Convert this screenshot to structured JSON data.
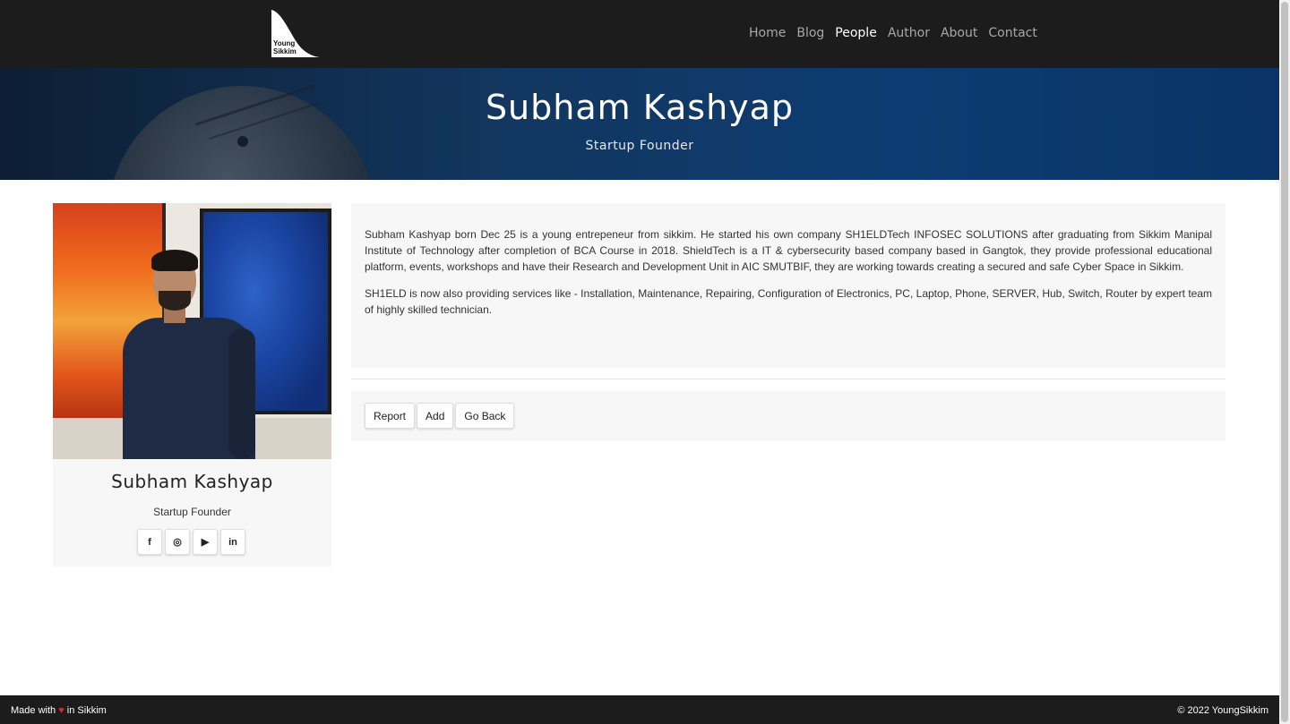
{
  "logo": {
    "text_line1": "Young",
    "text_line2": "Sikkim"
  },
  "nav": {
    "items": [
      {
        "label": "Home",
        "active": false
      },
      {
        "label": "Blog",
        "active": false
      },
      {
        "label": "People",
        "active": true
      },
      {
        "label": "Author",
        "active": false
      },
      {
        "label": "About",
        "active": false
      },
      {
        "label": "Contact",
        "active": false
      }
    ]
  },
  "hero": {
    "title": "Subham Kashyap",
    "subtitle": "Startup Founder"
  },
  "profile": {
    "name": "Subham Kashyap",
    "role": "Startup Founder",
    "socials": [
      {
        "name": "facebook-icon",
        "glyph": "f"
      },
      {
        "name": "instagram-icon",
        "glyph": "◎"
      },
      {
        "name": "youtube-icon",
        "glyph": "▶"
      },
      {
        "name": "linkedin-icon",
        "glyph": "in"
      }
    ]
  },
  "bio": {
    "paragraphs": [
      "Subham Kashyap born Dec 25 is a young entrepeneur from sikkim. He started his own company SH1ELDTech INFOSEC SOLUTIONS after graduating from Sikkim Manipal Institute of Technology after completion of BCA Course in 2018. ShieldTech is a IT & cybersecurity based company based in Gangtok, they provide professional educational platform, events, workshops and have their Research and Development Unit in AIC SMUTBIF, they are working towards creating a secured and safe Cyber Space in Sikkim.",
      "SH1ELD is now also providing services like - Installation, Maintenance, Repairing, Configuration of Electronics, PC, Laptop, Phone, SERVER, Hub, Switch, Router by expert team of highly skilled technician."
    ]
  },
  "actions": {
    "report": "Report",
    "add": "Add",
    "back": "Go Back"
  },
  "footer": {
    "made_prefix": "Made with",
    "heart": "♥",
    "made_suffix": "in Sikkim",
    "copyright": "© 2022 YoungSikkim"
  },
  "colors": {
    "navbar_bg": "#1c1c1c",
    "hero_blue": "#0d3c72",
    "heart": "#e02828"
  }
}
